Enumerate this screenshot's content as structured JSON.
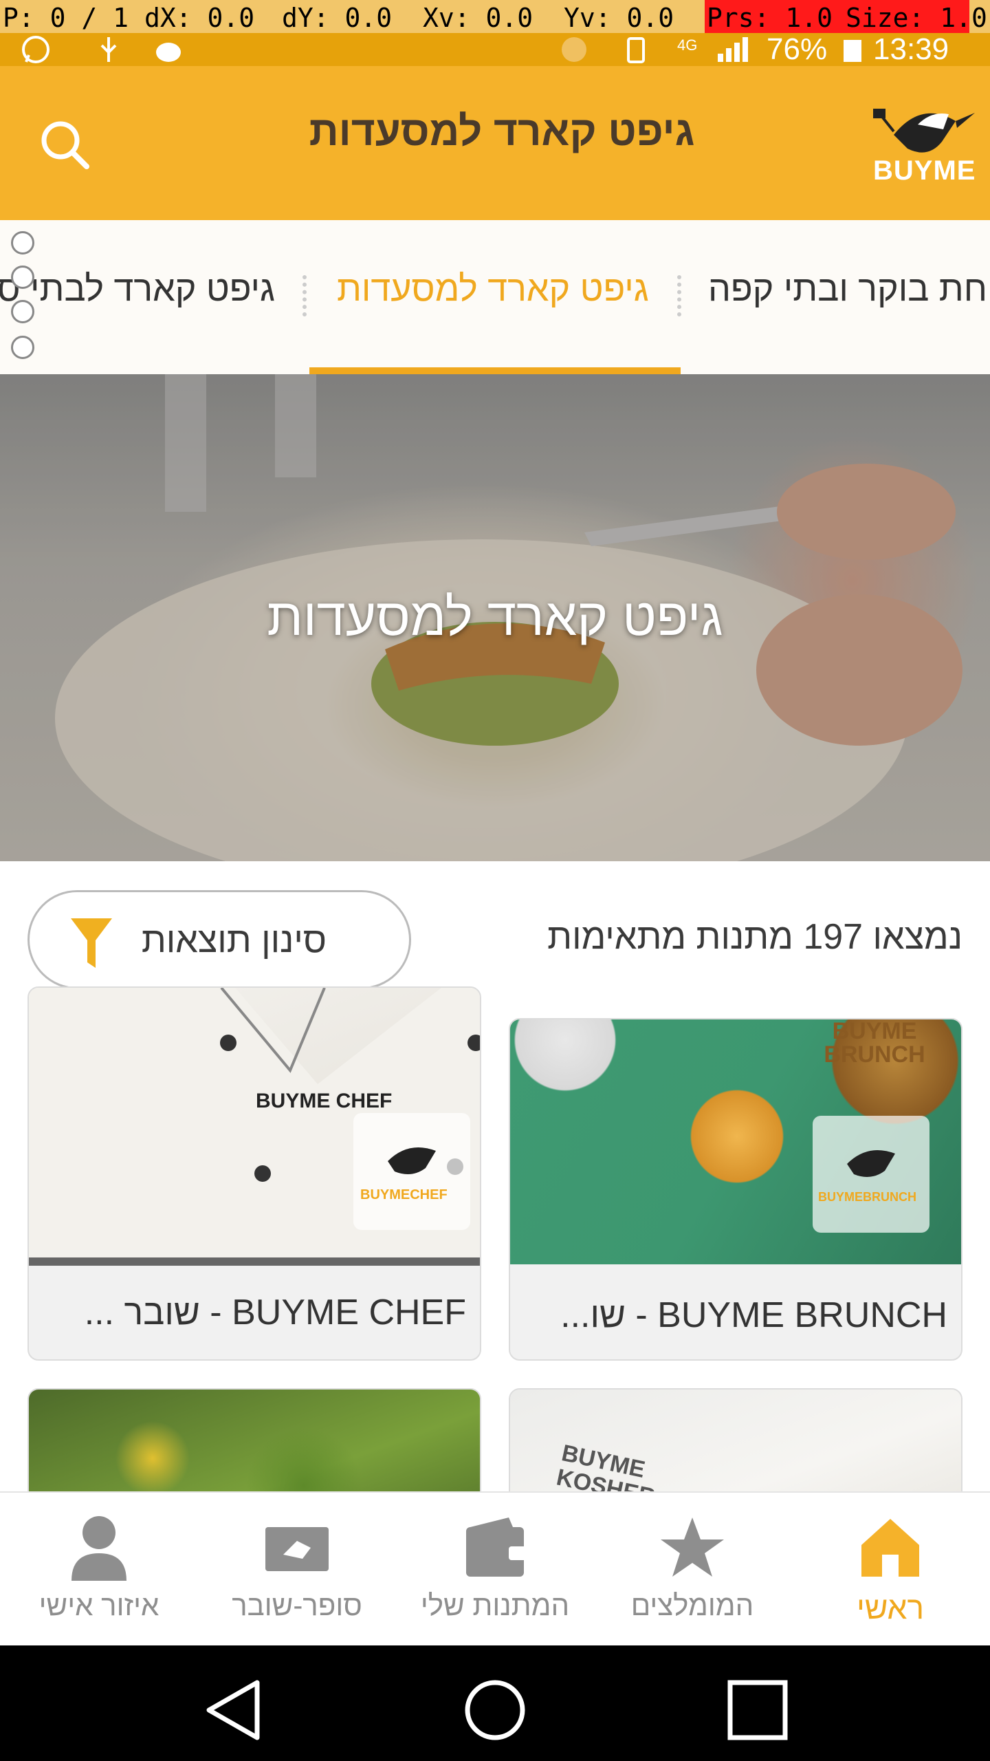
{
  "debug": {
    "pointer": "P: 0 / 1",
    "dx": "dX: 0.0",
    "dy": "dY: 0.0",
    "xv": "Xv: 0.0",
    "yv": "Yv: 0.0",
    "prs": "Prs: 1.0",
    "size": "Size: 1.0"
  },
  "status_bar": {
    "battery": "76%",
    "time": "13:39",
    "network": "4G"
  },
  "header": {
    "title": "גיפט קארד למסעדות",
    "logo_text": "BUYME",
    "search_icon": "search-icon"
  },
  "tabs": [
    {
      "label": "ארוחת בוקר ובתי קפה",
      "active": false
    },
    {
      "label": "גיפט קארד למסעדות",
      "active": true
    },
    {
      "label": "גיפט קארד לבתי ספא",
      "active": false
    }
  ],
  "hero": {
    "title": "גיפט קארד למסעדות"
  },
  "results": {
    "count_text": "נמצאו 197 מתנות מתאימות",
    "filter_label": "סינון תוצאות",
    "filter_icon": "filter-icon"
  },
  "cards": [
    {
      "label": "BUYME CHEF - שובר ...",
      "image_text": "BUYME CHEF",
      "badge": "BUYMECHEF"
    },
    {
      "label": "BUYME BRUNCH - שו...",
      "image_text": "BUYME BRUNCH",
      "badge": "BUYMEBRUNCH"
    },
    {
      "label": ""
    },
    {
      "label": "",
      "image_text": "BUYME KOSHER"
    }
  ],
  "bottom_nav": [
    {
      "label": "ראשי",
      "icon": "home-icon",
      "active": true
    },
    {
      "label": "המומלצים",
      "icon": "star-icon",
      "active": false
    },
    {
      "label": "המתנות שלי",
      "icon": "wallet-icon",
      "active": false
    },
    {
      "label": "סופר-שובר",
      "icon": "gift-card-icon",
      "active": false
    },
    {
      "label": "איזור אישי",
      "icon": "person-icon",
      "active": false
    }
  ],
  "colors": {
    "brand_yellow": "#f5b22a",
    "accent_orange": "#f0a81e",
    "status_bar": "#e6a20b"
  }
}
